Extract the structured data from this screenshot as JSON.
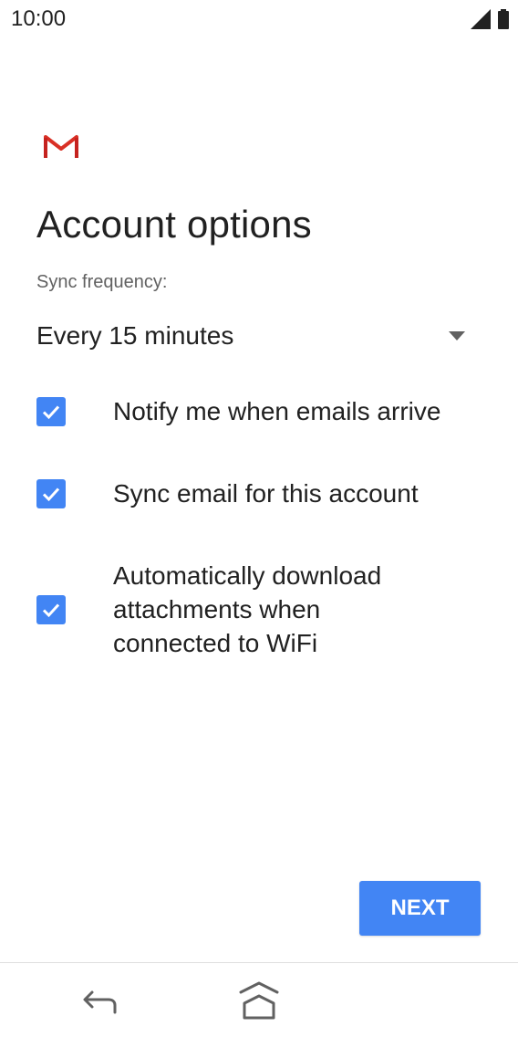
{
  "status_bar": {
    "time": "10:00",
    "icons": [
      "signal-icon",
      "battery-icon"
    ]
  },
  "app": {
    "logo": "gmail-icon",
    "title": "Account options"
  },
  "sync": {
    "label": "Sync frequency:",
    "selected": "Every 15 minutes"
  },
  "options": [
    {
      "label": "Notify me when emails arrive",
      "checked": true
    },
    {
      "label": "Sync email for this account",
      "checked": true
    },
    {
      "label": "Automatically download attachments when connected to WiFi",
      "checked": true
    }
  ],
  "actions": {
    "next_label": "NEXT"
  },
  "nav": {
    "icons": [
      "back-icon",
      "home-icon"
    ]
  },
  "colors": {
    "accent": "#4285f4",
    "gmail_red": "#d93025",
    "text": "#212121",
    "secondary_text": "#616161"
  }
}
